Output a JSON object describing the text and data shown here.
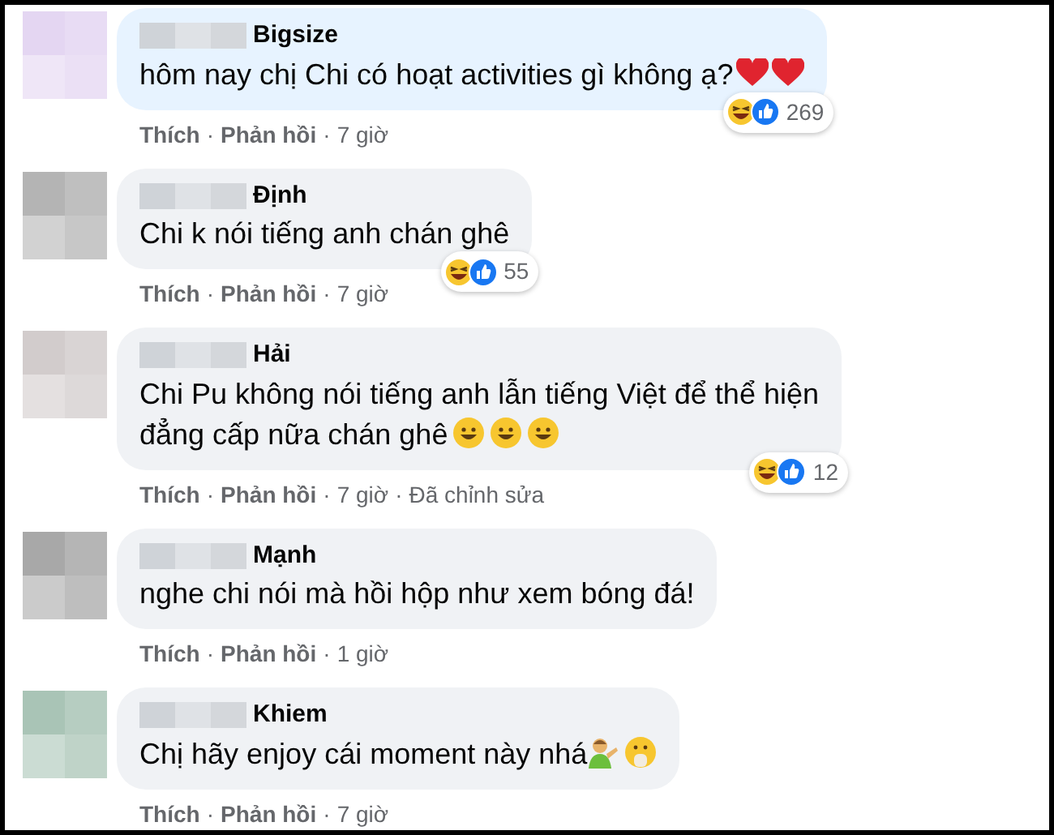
{
  "comments": [
    {
      "name": "Bigsize",
      "color": "#e7f3ff",
      "lines": [
        "hôm nay chị Chi có hoạt activities gì không ạ?"
      ],
      "trailing_icons": [
        {
          "kind": "heart"
        },
        {
          "kind": "heart"
        }
      ],
      "reaction_count": "269",
      "meta": [
        {
          "kind": "link",
          "label": "Thích"
        },
        {
          "kind": "dot",
          "label": "·"
        },
        {
          "kind": "link",
          "label": "Phản hồi"
        },
        {
          "kind": "dot",
          "label": "·"
        },
        {
          "kind": "time",
          "label": "7 giờ"
        }
      ]
    },
    {
      "name": "Định",
      "color": "#f0f2f5",
      "lines": [
        "Chi k nói tiếng anh chán ghê"
      ],
      "reaction_count": "55",
      "meta": [
        {
          "kind": "link",
          "label": "Thích"
        },
        {
          "kind": "dot",
          "label": "·"
        },
        {
          "kind": "link",
          "label": "Phản hồi"
        },
        {
          "kind": "dot",
          "label": "·"
        },
        {
          "kind": "time",
          "label": "7 giờ"
        }
      ]
    },
    {
      "name": "Hải",
      "color": "#f0f2f5",
      "lines": [
        "Chi Pu không nói tiếng anh lẫn tiếng Việt để thể hiện",
        "đẳng cấp nữa chán ghê"
      ],
      "trailing_icons": [
        {
          "kind": "smiley"
        },
        {
          "kind": "smiley"
        },
        {
          "kind": "smiley"
        }
      ],
      "reaction_count": "12",
      "meta": [
        {
          "kind": "link",
          "label": "Thích"
        },
        {
          "kind": "dot",
          "label": "·"
        },
        {
          "kind": "link",
          "label": "Phản hồi"
        },
        {
          "kind": "dot",
          "label": "·"
        },
        {
          "kind": "time",
          "label": "7 giờ"
        },
        {
          "kind": "dot",
          "label": "·"
        },
        {
          "kind": "time",
          "label": "Đã chỉnh sửa"
        }
      ]
    },
    {
      "name": "Mạnh",
      "color": "#f0f2f5",
      "lines": [
        "nghe chi nói mà hồi hộp như xem bóng đá!"
      ],
      "meta": [
        {
          "kind": "link",
          "label": "Thích"
        },
        {
          "kind": "dot",
          "label": "·"
        },
        {
          "kind": "link",
          "label": "Phản hồi"
        },
        {
          "kind": "dot",
          "label": "·"
        },
        {
          "kind": "time",
          "label": "1 giờ"
        }
      ]
    },
    {
      "name": "Khiem",
      "color": "#f0f2f5",
      "lines": [
        "Chị hãy enjoy cái moment này nhá"
      ],
      "trailing_icons": [
        {
          "kind": "person"
        },
        {
          "kind": "shush"
        }
      ],
      "meta": [
        {
          "kind": "link",
          "label": "Thích"
        },
        {
          "kind": "dot",
          "label": "·"
        },
        {
          "kind": "link",
          "label": "Phản hồi"
        },
        {
          "kind": "dot",
          "label": "·"
        },
        {
          "kind": "time",
          "label": "7 giờ"
        }
      ]
    }
  ]
}
